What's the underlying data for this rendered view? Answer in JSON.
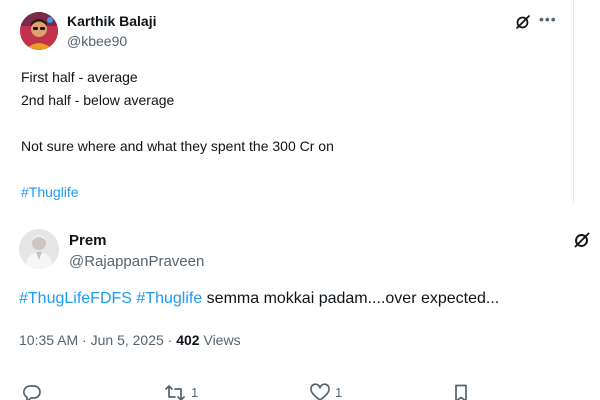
{
  "tweets": [
    {
      "author": {
        "name": "Karthik Balaji",
        "handle": "@kbee90"
      },
      "lines": [
        "First half - average",
        "2nd half - below average",
        "",
        "Not sure where and what they spent the 300 Cr on",
        ""
      ],
      "hashtag": "#Thuglife",
      "icons": [
        "grok-icon",
        "more-icon"
      ]
    },
    {
      "author": {
        "name": "Prem",
        "handle": "@RajappanPraveen"
      },
      "body": {
        "hashtag1": "#ThugLifeFDFS",
        "hashtag2": "#Thuglife",
        "text": " semma mokkai padam....over expected..."
      },
      "meta": {
        "time": "10:35 AM",
        "separator": " · ",
        "date": "Jun 5, 2025",
        "views_count": "402",
        "views_label": " Views"
      },
      "actions": {
        "reply_count": "",
        "retweet_count": "1",
        "like_count": "1"
      },
      "icons": [
        "grok-icon",
        "reply-icon",
        "retweet-icon",
        "like-icon",
        "bookmark-icon"
      ]
    }
  ],
  "colors": {
    "text": "#0f1419",
    "secondary": "#536471",
    "link": "#1d9bf0",
    "divider": "#e6e9eb"
  }
}
